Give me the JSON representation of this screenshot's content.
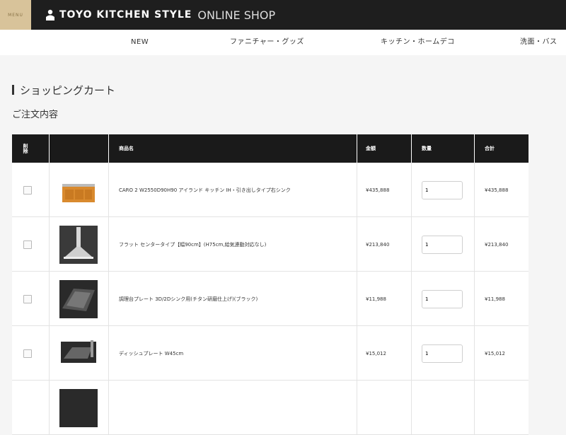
{
  "header": {
    "menu_label": "MENU",
    "brand_name": "TOYO KITCHEN STYLE",
    "brand_sub": "ONLINE SHOP"
  },
  "nav": {
    "items": [
      "NEW",
      "ファニチャー・グッズ",
      "キッチン・ホームデコ",
      "洗面・バス"
    ]
  },
  "page": {
    "title": "ショッピングカート",
    "subtitle": "ご注文内容"
  },
  "cart": {
    "columns": {
      "delete": "削除",
      "product": "商品名",
      "price": "金額",
      "qty": "数量",
      "total": "合計"
    },
    "rows": [
      {
        "name": "CARO 2 W2550D90H90 アイランド キッチン IH・引き出しタイプ右シンク",
        "price": "¥435,888",
        "qty": "1",
        "total": "¥435,888",
        "image": "kitchen-unit-image"
      },
      {
        "name": "フラット センタータイプ【幅90cm】(H75cm,給気連動対応なし)",
        "price": "¥213,840",
        "qty": "1",
        "total": "¥213,840",
        "image": "range-hood-image"
      },
      {
        "name": "調理台プレート 3D/2Dシンク用(チタン研磨仕上げ)(ブラック)",
        "price": "¥11,988",
        "qty": "1",
        "total": "¥11,988",
        "image": "cooking-plate-image"
      },
      {
        "name": "ディッシュプレート W45cm",
        "price": "¥15,012",
        "qty": "1",
        "total": "¥15,012",
        "image": "dish-plate-image"
      },
      {
        "name": "",
        "price": "",
        "qty": "",
        "total": "",
        "image": "product-image"
      }
    ]
  }
}
